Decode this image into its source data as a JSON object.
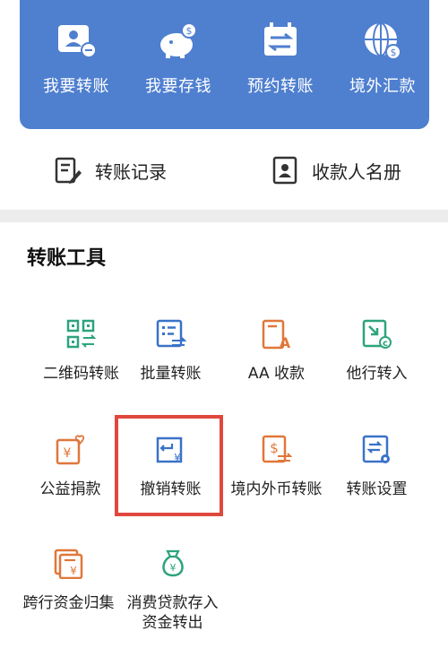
{
  "top_actions": [
    {
      "label": "我要转账",
      "icon": "contact-card-icon"
    },
    {
      "label": "我要存钱",
      "icon": "piggy-bank-icon"
    },
    {
      "label": "预约转账",
      "icon": "calendar-transfer-icon"
    },
    {
      "label": "境外汇款",
      "icon": "globe-dollar-icon"
    }
  ],
  "quick_links": [
    {
      "label": "转账记录",
      "icon": "record-edit-icon"
    },
    {
      "label": "收款人名册",
      "icon": "payee-book-icon"
    }
  ],
  "section_title": "转账工具",
  "tools": [
    {
      "label": "二维码转账",
      "icon": "qr-transfer-icon"
    },
    {
      "label": "批量转账",
      "icon": "batch-list-icon"
    },
    {
      "label": "AA 收款",
      "icon": "aa-collect-icon"
    },
    {
      "label": "他行转入",
      "icon": "other-bank-in-icon"
    },
    {
      "label": "公益捐款",
      "icon": "charity-heart-icon"
    },
    {
      "label": "撤销转账",
      "icon": "revoke-transfer-icon"
    },
    {
      "label": "境内外币转账",
      "icon": "foreign-currency-icon"
    },
    {
      "label": "转账设置",
      "icon": "transfer-settings-icon"
    },
    {
      "label": "跨行资金归集",
      "icon": "cross-bank-collect-icon"
    },
    {
      "label_line1": "消费贷款存入",
      "label_line2": "资金转出",
      "icon": "loan-bag-icon"
    }
  ],
  "colors": {
    "panel_blue": "#4f7fcf",
    "icon_green": "#2ea37e",
    "icon_blue": "#3a72c8",
    "icon_orange": "#e0773a",
    "highlight_red": "#e0473d"
  }
}
